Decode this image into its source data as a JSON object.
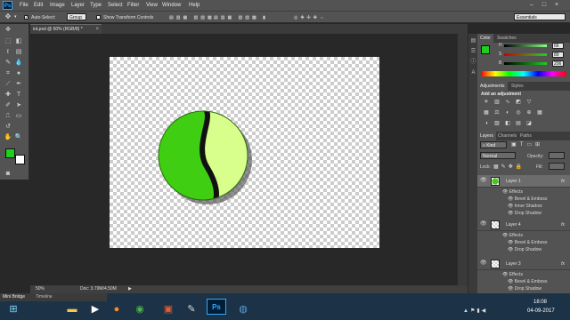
{
  "menu": {
    "logo": "Ps",
    "items": [
      "File",
      "Edit",
      "Image",
      "Layer",
      "Type",
      "Select",
      "Filter",
      "View",
      "Window",
      "Help"
    ]
  },
  "window_controls": [
    "–",
    "□",
    "×"
  ],
  "options": {
    "auto_select_label": "Auto-Select:",
    "auto_select_value": "Group",
    "show_transform_label": "Show Transform Controls",
    "workspace": "Essentials"
  },
  "document": {
    "tab_title": "ioLpsd @ 50% (RGB/8) *",
    "close": "×",
    "zoom": "50%",
    "doc_info": "Doc: 3.79M/4.50M"
  },
  "color_panel": {
    "tabs": [
      "Color",
      "Swatches"
    ],
    "sliders": [
      {
        "label": "H",
        "value": "66"
      },
      {
        "label": "S",
        "value": "89"
      },
      {
        "label": "B",
        "value": "206"
      }
    ],
    "fg_color": "#1ed01e",
    "bg_color": "#ffffff"
  },
  "adjustments_panel": {
    "tabs": [
      "Adjustments",
      "Styles"
    ],
    "heading": "Add an adjustment"
  },
  "layers_panel": {
    "tabs": [
      "Layers",
      "Channels",
      "Paths"
    ],
    "kind": "Kind",
    "blend_mode": "Normal",
    "opacity_label": "Opacity:",
    "lock_label": "Lock:",
    "fill_label": "Fill:",
    "fx": "fx",
    "layers": [
      {
        "name": "Layer 1",
        "effects_label": "Effects",
        "effects": [
          "Bevel & Emboss",
          "Inner Shadow",
          "Drop Shadow"
        ]
      },
      {
        "name": "Layer 4",
        "effects_label": "Effects",
        "effects": [
          "Bevel & Emboss",
          "Drop Shadow"
        ]
      },
      {
        "name": "Layer 3",
        "effects_label": "Effects",
        "effects": [
          "Bevel & Emboss",
          "Drop Shadow"
        ]
      }
    ]
  },
  "bottom_tabs": [
    "Mini Bridge",
    "Timeline"
  ],
  "taskbar": {
    "time": "18:08",
    "date": "04-09-2017"
  },
  "artwork": {
    "dark_green": "#3fce12",
    "light_green": "#d8ff8c",
    "divider": "#111111"
  }
}
